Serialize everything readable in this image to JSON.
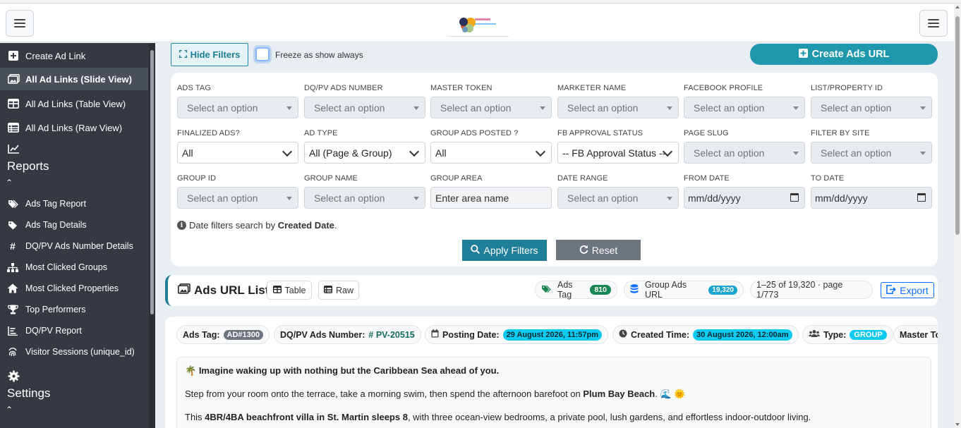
{
  "header": {
    "left_menu_icon": "hamburger-icon",
    "right_menu_icon": "hamburger-icon",
    "logo_icon": "brand-logo"
  },
  "sidebar": {
    "items": [
      {
        "label": "Create Ad Link",
        "icon": "plus-square-icon"
      },
      {
        "label": "All Ad Links (Slide View)",
        "icon": "images-icon",
        "active": true
      },
      {
        "label": "All Ad Links (Table View)",
        "icon": "table-icon"
      },
      {
        "label": "All Ad Links (Raw View)",
        "icon": "list-table-icon"
      }
    ],
    "reports_heading": "Reports",
    "reports": [
      {
        "label": "Ads Tag Report",
        "icon": "tags-icon"
      },
      {
        "label": "Ads Tag Details",
        "icon": "tag-icon"
      },
      {
        "label": "DQ/PV Ads Number Details",
        "icon": "hash-icon"
      },
      {
        "label": "Most Clicked Groups",
        "icon": "sitemap-icon"
      },
      {
        "label": "Most Clicked Properties",
        "icon": "house-icon"
      },
      {
        "label": "Top Performers",
        "icon": "trophy-icon"
      },
      {
        "label": "DQ/PV Report",
        "icon": "list-bars-icon"
      },
      {
        "label": "Visitor Sessions (unique_id)",
        "icon": "fingerprint-icon"
      }
    ],
    "settings_heading": "Settings"
  },
  "toolbar": {
    "hide_filters_label": "Hide Filters",
    "freeze_label": "Freeze as show always",
    "create_ads_url_label": "Create Ads URL"
  },
  "filters": {
    "row1": [
      {
        "label": "ADS TAG",
        "placeholder": "Select an option"
      },
      {
        "label": "DQ/PV ADS NUMBER",
        "placeholder": "Select an option"
      },
      {
        "label": "MASTER TOKEN",
        "placeholder": "Select an option"
      },
      {
        "label": "MARKETER NAME",
        "placeholder": "Select an option"
      },
      {
        "label": "FACEBOOK PROFILE",
        "placeholder": "Select an option"
      },
      {
        "label": "LIST/PROPERTY ID",
        "placeholder": "Select an option"
      }
    ],
    "row2": [
      {
        "label": "FINALIZED ADS?",
        "value": "All"
      },
      {
        "label": "AD TYPE",
        "value": "All (Page & Group)"
      },
      {
        "label": "GROUP ADS POSTED ?",
        "value": "All"
      },
      {
        "label": "FB APPROVAL STATUS",
        "value": "-- FB Approval Status --"
      },
      {
        "label": "PAGE SLUG",
        "placeholder": "Select an option"
      },
      {
        "label": "FILTER BY SITE",
        "placeholder": "Select an option"
      }
    ],
    "row3": [
      {
        "label": "GROUP ID",
        "placeholder": "Select an option"
      },
      {
        "label": "GROUP NAME",
        "placeholder": "Select an option"
      },
      {
        "label": "GROUP AREA",
        "placeholder": "Enter area name"
      },
      {
        "label": "DATE RANGE",
        "placeholder": "Select an option"
      },
      {
        "label": "FROM DATE",
        "value": "mm/dd/yyyy"
      },
      {
        "label": "TO DATE",
        "value": "mm/dd/yyyy"
      }
    ],
    "note_prefix": "Date filters search by ",
    "note_bold": "Created Date",
    "note_suffix": ".",
    "apply_label": "Apply Filters",
    "reset_label": "Reset"
  },
  "list": {
    "title": "Ads URL List",
    "table_label": "Table",
    "raw_label": "Raw",
    "ads_tag_label": "Ads Tag",
    "ads_tag_count": "810",
    "group_ads_label": "Group Ads URL",
    "group_ads_count": "19,320",
    "pagination": "1–25 of 19,320 · page 1/773",
    "export_label": "Export"
  },
  "ad": {
    "ads_tag_label": "Ads Tag:",
    "ads_tag_value": "AD#1300",
    "dqpv_label": "DQ/PV Ads Number:",
    "dqpv_value": "# PV-20515",
    "posting_label": "Posting Date:",
    "posting_value": "29 August 2026, 11:57pm",
    "created_label": "Created Time:",
    "created_value": "30 August 2026, 12:00am",
    "type_label": "Type:",
    "type_value": "GROUP",
    "master_label": "Master Tok",
    "line1": "Imagine waking up with nothing but the Caribbean Sea ahead of you.",
    "line2_a": "Step from your room onto the terrace, take a morning swim, then spend the afternoon barefoot on ",
    "line2_bold": "Plum Bay Beach",
    "line2_b": ". 🌊 🌞",
    "line3_a": "This ",
    "line3_bold": "4BR/4BA beachfront villa in St. Martin sleeps 8",
    "line3_b": ", with three ocean-view bedrooms, a private pool, lush gardens, and effortless indoor-outdoor living."
  },
  "colors": {
    "sidebar_bg": "#343a40",
    "accent": "#1f98ae",
    "apply": "#1f7e98",
    "reset": "#6c757d"
  }
}
